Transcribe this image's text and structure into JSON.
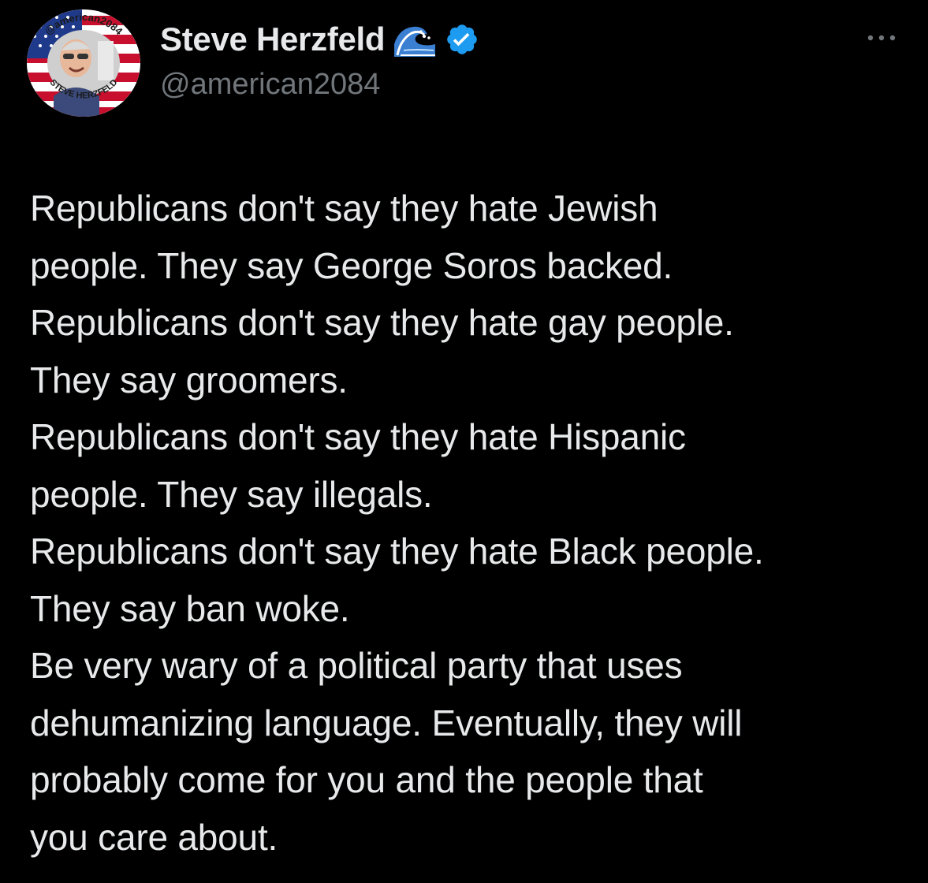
{
  "tweet": {
    "author": {
      "display_name": "Steve Herzfeld",
      "handle": "@american2084",
      "name_emoji_icon": "water-wave-icon",
      "verified_icon": "verified-badge-icon",
      "avatar_icon": "profile-photo",
      "avatar_ring_text_top": "@american2084",
      "avatar_ring_text_bottom": "STEVE HERZFELD",
      "verified_color": "#1d9bf0"
    },
    "more_icon": "more-options-icon",
    "text_lines": [
      "Republicans don't say they hate Jewish",
      "people. They say George Soros backed.",
      "Republicans don't say they hate gay people.",
      "They say groomers.",
      "Republicans don't say they hate Hispanic",
      "people. They say illegals.",
      "Republicans don't say they hate Black people.",
      "They say ban woke.",
      "Be very wary of a political party that uses",
      "dehumanizing language. Eventually, they will",
      "probably come for you and the people that",
      "you care about."
    ]
  },
  "theme": {
    "background": "#000000",
    "text_primary": "#e7e9ea",
    "text_secondary": "#71767b"
  }
}
